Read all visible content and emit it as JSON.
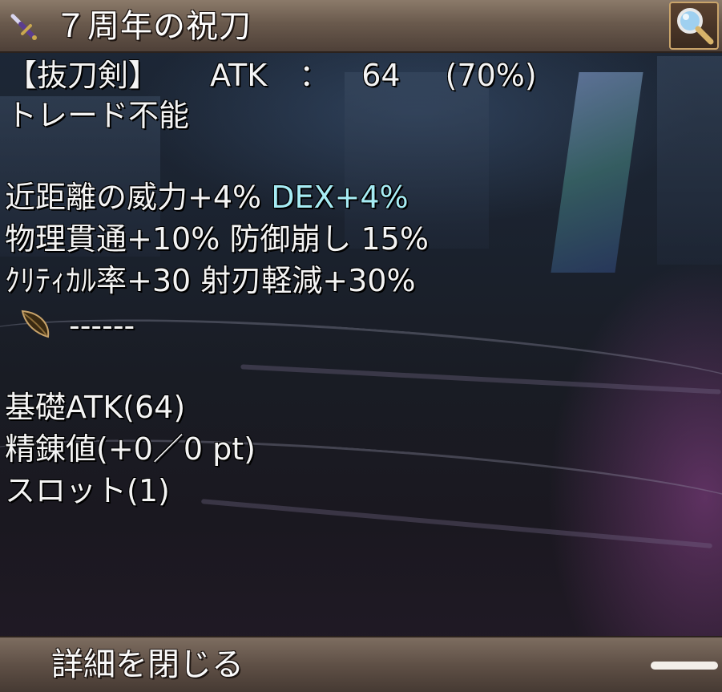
{
  "window": {
    "title": "７周年の祝刀",
    "title_icon": "sword-icon",
    "zoom_icon": "magnifier-icon"
  },
  "item": {
    "type_line_label": "【抜刀剣】",
    "atk_label": "ATK",
    "atk_separator": "：",
    "atk_value": "64",
    "atk_percent": "(70%)",
    "trade_status": "トレード不能",
    "effects": [
      {
        "main": "近距離の威力+4% ",
        "highlight": "DEX+4%"
      },
      {
        "main": "物理貫通+10% 防御崩し 15%",
        "highlight": ""
      },
      {
        "main": "ｸﾘﾃｨｶﾙ率+30 射刃軽減+30%",
        "highlight": ""
      }
    ],
    "card_slot_icon": "leaf-card-icon",
    "card_slot_text": "------",
    "base_atk": "基礎ATK(64)",
    "refine": "精錬値(+0／0 pt)",
    "slots": "スロット(1)"
  },
  "footer": {
    "close_details_label": "詳細を閉じる"
  },
  "colors": {
    "highlight_text": "#a6ecf4",
    "title_bar": "#6a5a4d",
    "footer_bar": "#5f5046"
  }
}
